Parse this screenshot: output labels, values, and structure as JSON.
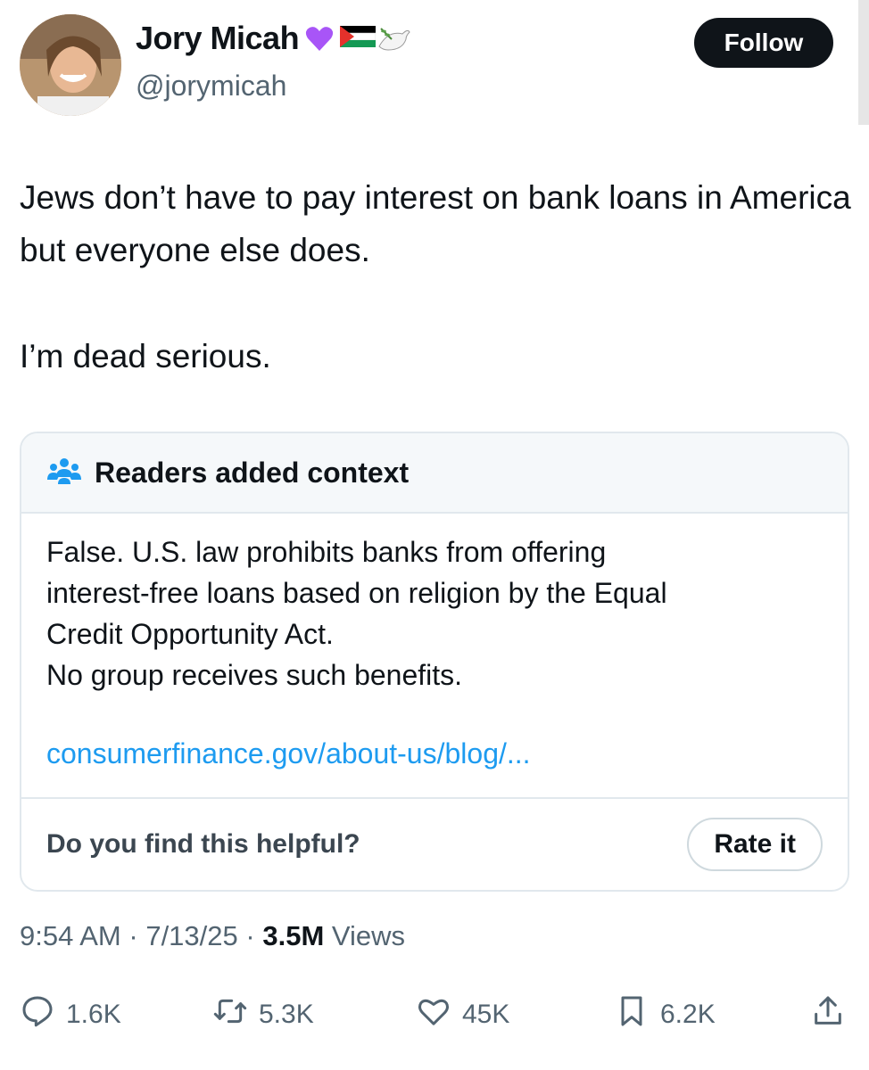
{
  "author": {
    "name": "Jory Micah",
    "handle": "@jorymicah",
    "badge_emojis": [
      "purple-heart",
      "palestine-flag",
      "dove-with-olive-branch"
    ]
  },
  "follow_label": "Follow",
  "tweet": {
    "paragraphs": [
      "Jews don’t have to pay interest on bank loans in America but everyone else does.",
      "I’m dead serious."
    ]
  },
  "community_note": {
    "title": "Readers added context",
    "lines": [
      "False. U.S. law prohibits banks from offering",
      "interest-free loans  based on religion by the Equal",
      "Credit Opportunity Act.",
      "No group receives such benefits."
    ],
    "link": "consumerfinance.gov/about-us/blog/...",
    "question": "Do you find this helpful?",
    "rate_label": "Rate it"
  },
  "meta": {
    "time": "9:54 AM",
    "date": "7/13/25",
    "views_count": "3.5M",
    "views_label": "Views",
    "separator": "·"
  },
  "actions": {
    "replies": "1.6K",
    "reposts": "5.3K",
    "likes": "45K",
    "bookmarks": "6.2K"
  },
  "colors": {
    "text": "#0f1419",
    "muted": "#536471",
    "link": "#1d9bf0",
    "border": "#e1e8ed",
    "note_icon": "#1d9bf0"
  }
}
